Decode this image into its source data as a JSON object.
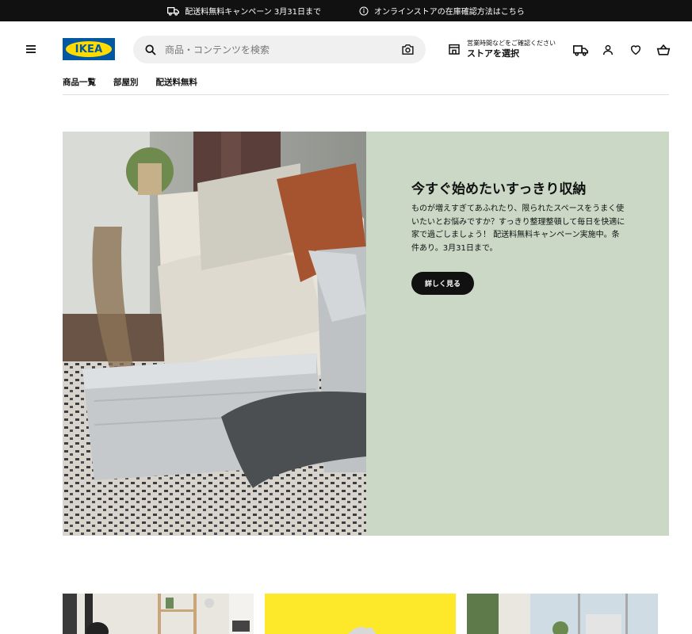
{
  "topbar": {
    "shipping_promo": "配送料無料キャンペーン 3月31日まで",
    "stock_info": "オンラインストアの在庫確認方法はこちら"
  },
  "header": {
    "logo_text": "IKEA",
    "search_placeholder": "商品・コンテンツを検索",
    "store_small": "営業時間などをご確認ください",
    "store_label": "ストアを選択"
  },
  "nav": {
    "items": [
      "商品一覧",
      "部屋別",
      "配送料無料"
    ]
  },
  "hero": {
    "title": "今すぐ始めたいすっきり収納",
    "body": "ものが増えすぎてあふれたり、限られたスペースをうまく使いたいとお悩みですか？すっきり整理整頓して毎日を快適に家で過ごしましょう！ 配送料無料キャンペーン実施中。条件あり。3月31日まで。",
    "button": "詳しく見る"
  },
  "colors": {
    "topbar_bg": "#111111",
    "logo_blue": "#0058a3",
    "logo_yellow": "#ffdb00",
    "hero_panel": "#cad8c5",
    "card_yellow": "#fde92a"
  }
}
